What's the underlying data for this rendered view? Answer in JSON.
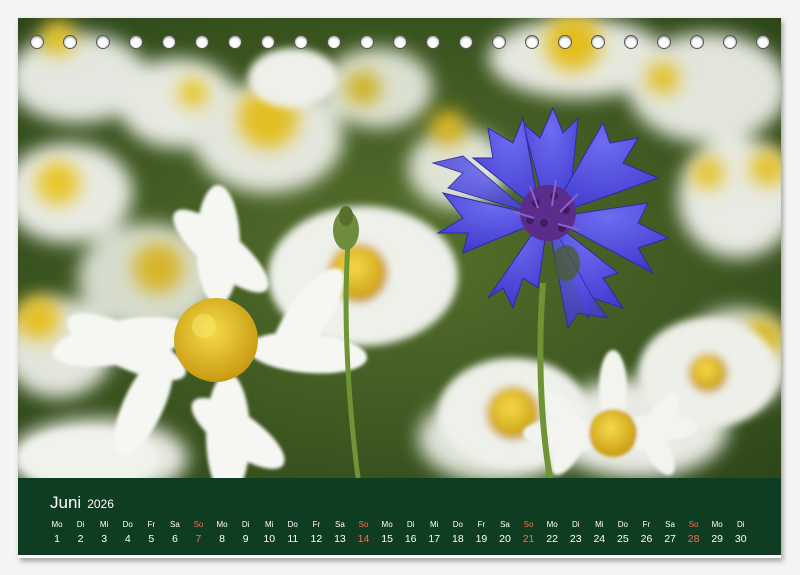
{
  "calendar": {
    "month": "Juni",
    "year": "2026",
    "ring_count": 23,
    "days": [
      {
        "weekday": "Mo",
        "day": "1"
      },
      {
        "weekday": "Di",
        "day": "2"
      },
      {
        "weekday": "Mi",
        "day": "3"
      },
      {
        "weekday": "Do",
        "day": "4"
      },
      {
        "weekday": "Fr",
        "day": "5"
      },
      {
        "weekday": "Sa",
        "day": "6"
      },
      {
        "weekday": "So",
        "day": "7",
        "sunday": true
      },
      {
        "weekday": "Mo",
        "day": "8"
      },
      {
        "weekday": "Di",
        "day": "9"
      },
      {
        "weekday": "Mi",
        "day": "10"
      },
      {
        "weekday": "Do",
        "day": "11"
      },
      {
        "weekday": "Fr",
        "day": "12"
      },
      {
        "weekday": "Sa",
        "day": "13"
      },
      {
        "weekday": "So",
        "day": "14",
        "sunday": true
      },
      {
        "weekday": "Mo",
        "day": "15"
      },
      {
        "weekday": "Di",
        "day": "16"
      },
      {
        "weekday": "Mi",
        "day": "17"
      },
      {
        "weekday": "Do",
        "day": "18"
      },
      {
        "weekday": "Fr",
        "day": "19"
      },
      {
        "weekday": "Sa",
        "day": "20"
      },
      {
        "weekday": "So",
        "day": "21",
        "sunday": true
      },
      {
        "weekday": "Mo",
        "day": "22"
      },
      {
        "weekday": "Di",
        "day": "23"
      },
      {
        "weekday": "Mi",
        "day": "24"
      },
      {
        "weekday": "Do",
        "day": "25"
      },
      {
        "weekday": "Fr",
        "day": "26"
      },
      {
        "weekday": "Sa",
        "day": "27"
      },
      {
        "weekday": "So",
        "day": "28",
        "sunday": true
      },
      {
        "weekday": "Mo",
        "day": "29"
      },
      {
        "weekday": "Di",
        "day": "30"
      }
    ]
  },
  "colors": {
    "bar": "#0f3d22",
    "sunday": "#ff6a4d",
    "cornflower": "#4a3fd6",
    "daisy_center": "#e8c21f",
    "foliage": "#3d5a22"
  },
  "photo": {
    "subject": "cornflower-among-daisies"
  }
}
